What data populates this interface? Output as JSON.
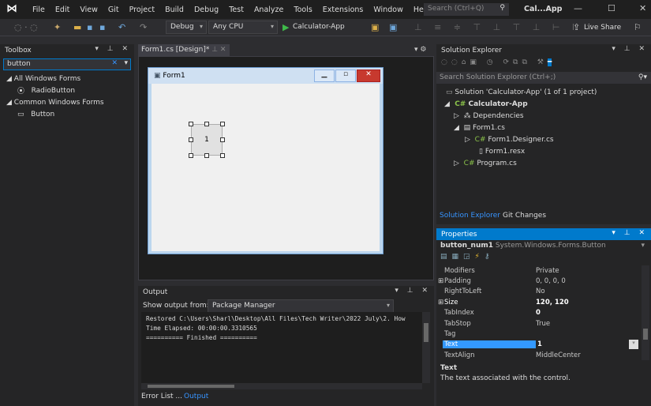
{
  "menu": {
    "items": [
      "File",
      "Edit",
      "View",
      "Git",
      "Project",
      "Build",
      "Debug",
      "Test",
      "Analyze",
      "Tools",
      "Extensions",
      "Window",
      "Help"
    ],
    "search_placeholder": "Search (Ctrl+Q)",
    "title": "Cal...App",
    "live_share": "Live Share"
  },
  "toolbar": {
    "config": "Debug",
    "platform": "Any CPU",
    "start": "Calculator-App"
  },
  "toolbox": {
    "title": "Toolbox",
    "search_value": "button",
    "groups": [
      {
        "label": "All Windows Forms",
        "items": [
          "RadioButton"
        ]
      },
      {
        "label": "Common Windows Forms",
        "items": [
          "Button"
        ]
      }
    ]
  },
  "document": {
    "tab": "Form1.cs [Design]*",
    "form_title": "Form1",
    "button_text": "1"
  },
  "output": {
    "title": "Output",
    "show_from_label": "Show output from:",
    "source": "Package Manager",
    "lines": [
      "Restored C:\\Users\\Sharl\\Desktop\\All Files\\Tech Writer\\2022 July\\2. How",
      "Time Elapsed: 00:00:00.3310565",
      "========== Finished =========="
    ],
    "tabs": [
      "Error List ...",
      "Output"
    ]
  },
  "solution_explorer": {
    "title": "Solution Explorer",
    "search_placeholder": "Search Solution Explorer (Ctrl+;)",
    "tree": [
      "Solution 'Calculator-App' (1 of 1 project)",
      "Calculator-App",
      "Dependencies",
      "Form1.cs",
      "Form1.Designer.cs",
      "Form1.resx",
      "Program.cs"
    ],
    "tabs": [
      "Solution Explorer",
      "Git Changes"
    ]
  },
  "properties": {
    "title": "Properties",
    "object": "button_num1",
    "type": "System.Windows.Forms.Button",
    "rows": [
      {
        "name": "Modifiers",
        "value": "Private"
      },
      {
        "name": "Padding",
        "value": "0, 0, 0, 0"
      },
      {
        "name": "RightToLeft",
        "value": "No"
      },
      {
        "name": "Size",
        "value": "120, 120"
      },
      {
        "name": "TabIndex",
        "value": "0"
      },
      {
        "name": "TabStop",
        "value": "True"
      },
      {
        "name": "Tag",
        "value": ""
      },
      {
        "name": "Text",
        "value": "1"
      },
      {
        "name": "TextAlign",
        "value": "MiddleCenter"
      }
    ],
    "desc_title": "Text",
    "desc": "The text associated with the control."
  },
  "colors": {
    "accent": "#007acc",
    "selection": "#3399ff"
  }
}
